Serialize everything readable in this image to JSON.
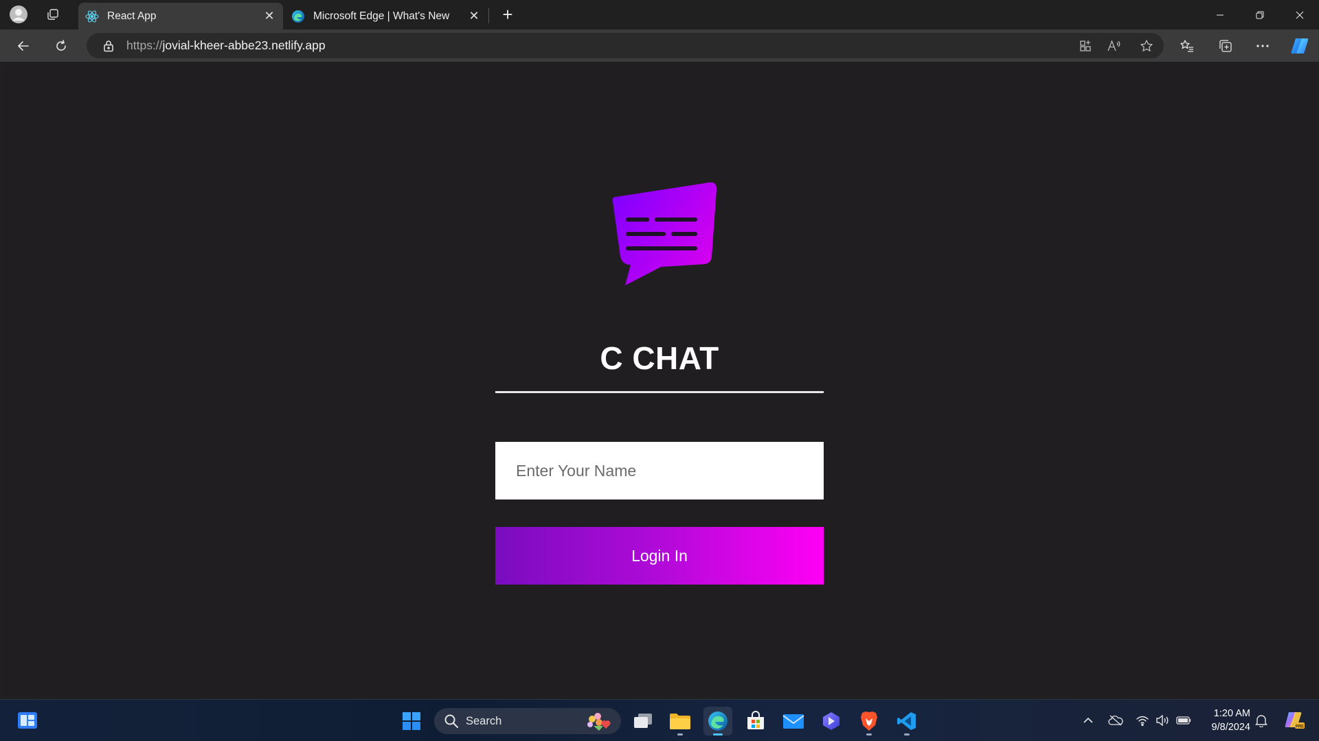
{
  "browser": {
    "tabs": [
      {
        "title": "React App",
        "active": true,
        "favicon": "react-icon"
      },
      {
        "title": "Microsoft Edge | What's New",
        "active": false,
        "favicon": "edge-icon"
      }
    ],
    "url_scheme": "https://",
    "url_host": "jovial-kheer-abbe23.netlify.app"
  },
  "page": {
    "app_title": "C CHAT",
    "name_placeholder": "Enter Your Name",
    "login_label": "Login In",
    "colors": {
      "background": "#201e20",
      "gradient_start": "#7a0cbf",
      "gradient_end": "#ff00f5",
      "logo_gradient_start": "#7b00ff",
      "logo_gradient_end": "#d200f0"
    }
  },
  "taskbar": {
    "search_label": "Search",
    "time": "1:20 AM",
    "date": "9/8/2024"
  }
}
